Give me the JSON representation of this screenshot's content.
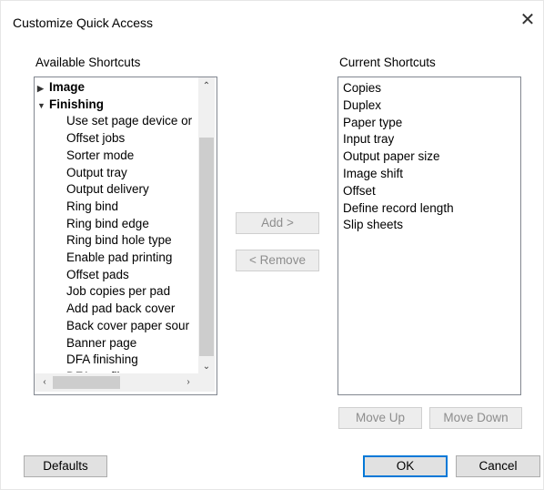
{
  "dialog": {
    "title": "Customize Quick Access",
    "close_glyph": "✕"
  },
  "available": {
    "label": "Available Shortcuts",
    "items": [
      {
        "text": "Image",
        "level": 0,
        "expanded": false
      },
      {
        "text": "Finishing",
        "level": 0,
        "expanded": true
      },
      {
        "text": "Use set page device or",
        "level": 1
      },
      {
        "text": "Offset jobs",
        "level": 1
      },
      {
        "text": "Sorter mode",
        "level": 1
      },
      {
        "text": "Output tray",
        "level": 1
      },
      {
        "text": "Output delivery",
        "level": 1
      },
      {
        "text": "Ring bind",
        "level": 1
      },
      {
        "text": "Ring bind edge",
        "level": 1
      },
      {
        "text": "Ring bind hole type",
        "level": 1
      },
      {
        "text": "Enable pad printing",
        "level": 1
      },
      {
        "text": "Offset pads",
        "level": 1
      },
      {
        "text": "Job copies per pad",
        "level": 1
      },
      {
        "text": "Add pad back cover",
        "level": 1
      },
      {
        "text": "Back cover paper sour",
        "level": 1
      },
      {
        "text": "Banner page",
        "level": 1
      },
      {
        "text": "DFA finishing",
        "level": 1
      },
      {
        "text": "DFA profile",
        "level": 1
      }
    ]
  },
  "buttons": {
    "add": "Add >",
    "remove": "< Remove",
    "move_up": "Move Up",
    "move_down": "Move Down",
    "defaults": "Defaults",
    "ok": "OK",
    "cancel": "Cancel"
  },
  "current": {
    "label": "Current Shortcuts",
    "items": [
      "Copies",
      "Duplex",
      "Paper type",
      "Input tray",
      "Output paper size",
      "Image shift",
      "Offset",
      "Define record length",
      "Slip sheets"
    ]
  },
  "colors": {
    "focus_border": "#0078d7",
    "list_border": "#828790"
  }
}
